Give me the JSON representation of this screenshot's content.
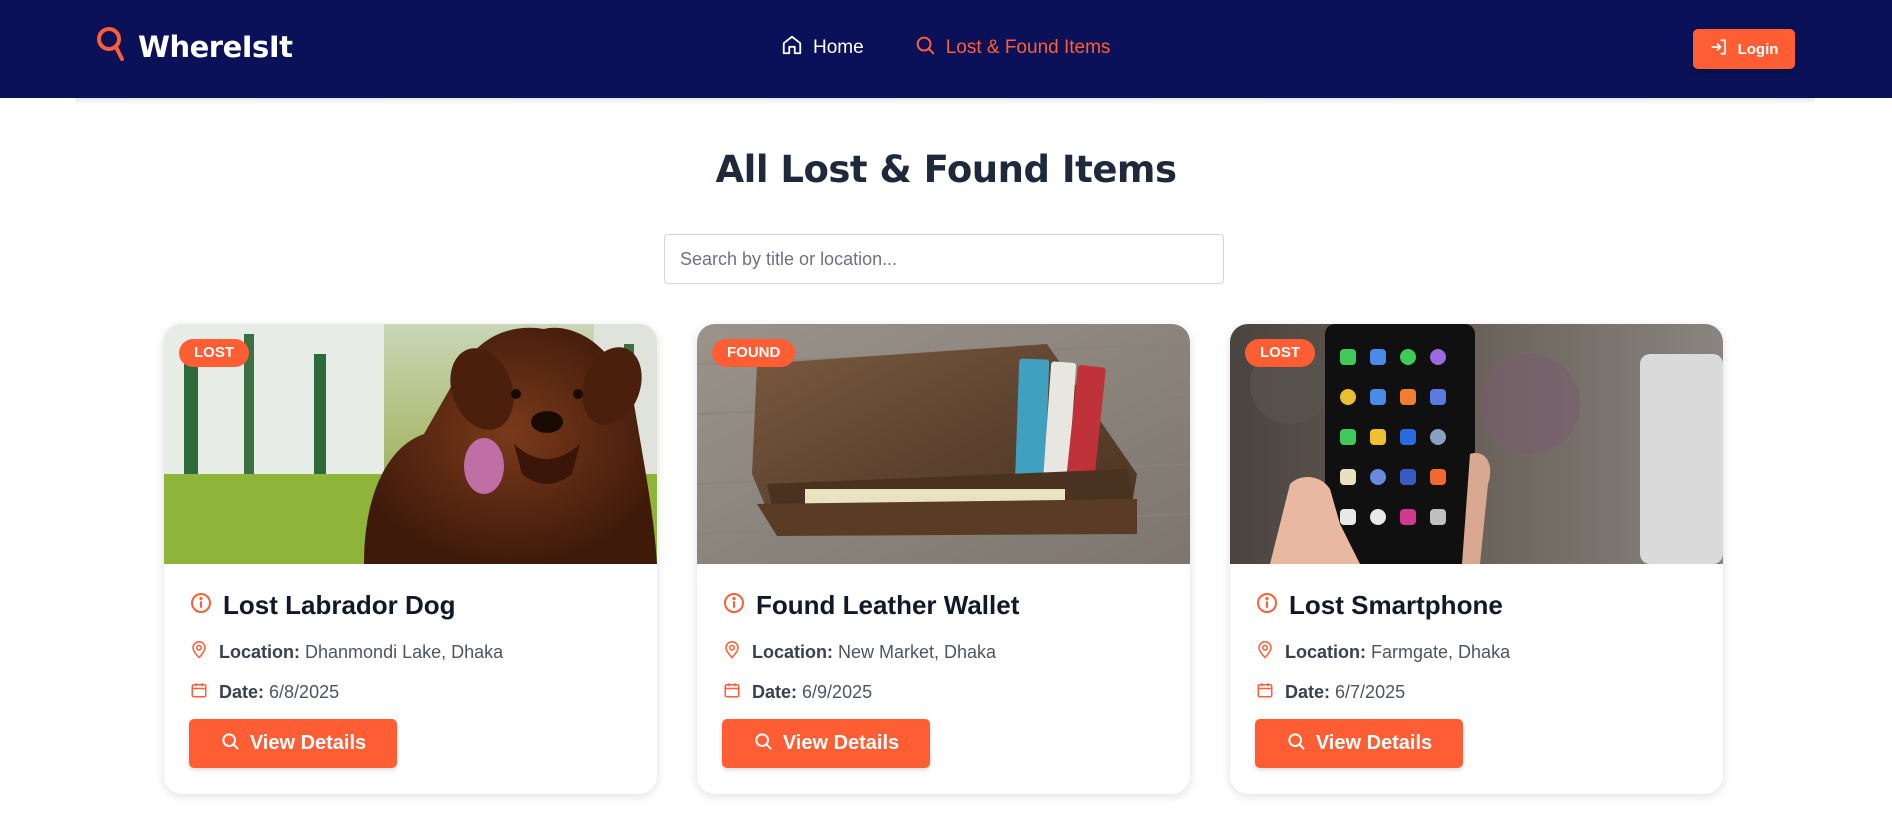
{
  "brand": {
    "name": "WhereIsIt",
    "icon": "search-icon",
    "accent_color": "#ff5e35",
    "nav_bg": "#0a1159"
  },
  "nav": {
    "home": {
      "label": "Home",
      "icon": "home-icon"
    },
    "lost_found": {
      "label": "Lost & Found Items",
      "icon": "search-icon"
    }
  },
  "login": {
    "label": "Login",
    "icon": "login-icon"
  },
  "page": {
    "title": "All Lost & Found Items",
    "search_placeholder": "Search by title or location..."
  },
  "items": [
    {
      "badge": "LOST",
      "title": "Lost Labrador Dog",
      "location_label": "Location:",
      "location": "Dhanmondi Lake, Dhaka",
      "date_label": "Date:",
      "date": "6/8/2025",
      "button": "View Details",
      "image": "brown dog photo"
    },
    {
      "badge": "FOUND",
      "title": "Found Leather Wallet",
      "location_label": "Location:",
      "location": "New Market, Dhaka",
      "date_label": "Date:",
      "date": "6/9/2025",
      "button": "View Details",
      "image": "leather wallet photo"
    },
    {
      "badge": "LOST",
      "title": "Lost Smartphone",
      "location_label": "Location:",
      "location": "Farmgate, Dhaka",
      "date_label": "Date:",
      "date": "6/7/2025",
      "button": "View Details",
      "image": "smartphone photo"
    }
  ]
}
